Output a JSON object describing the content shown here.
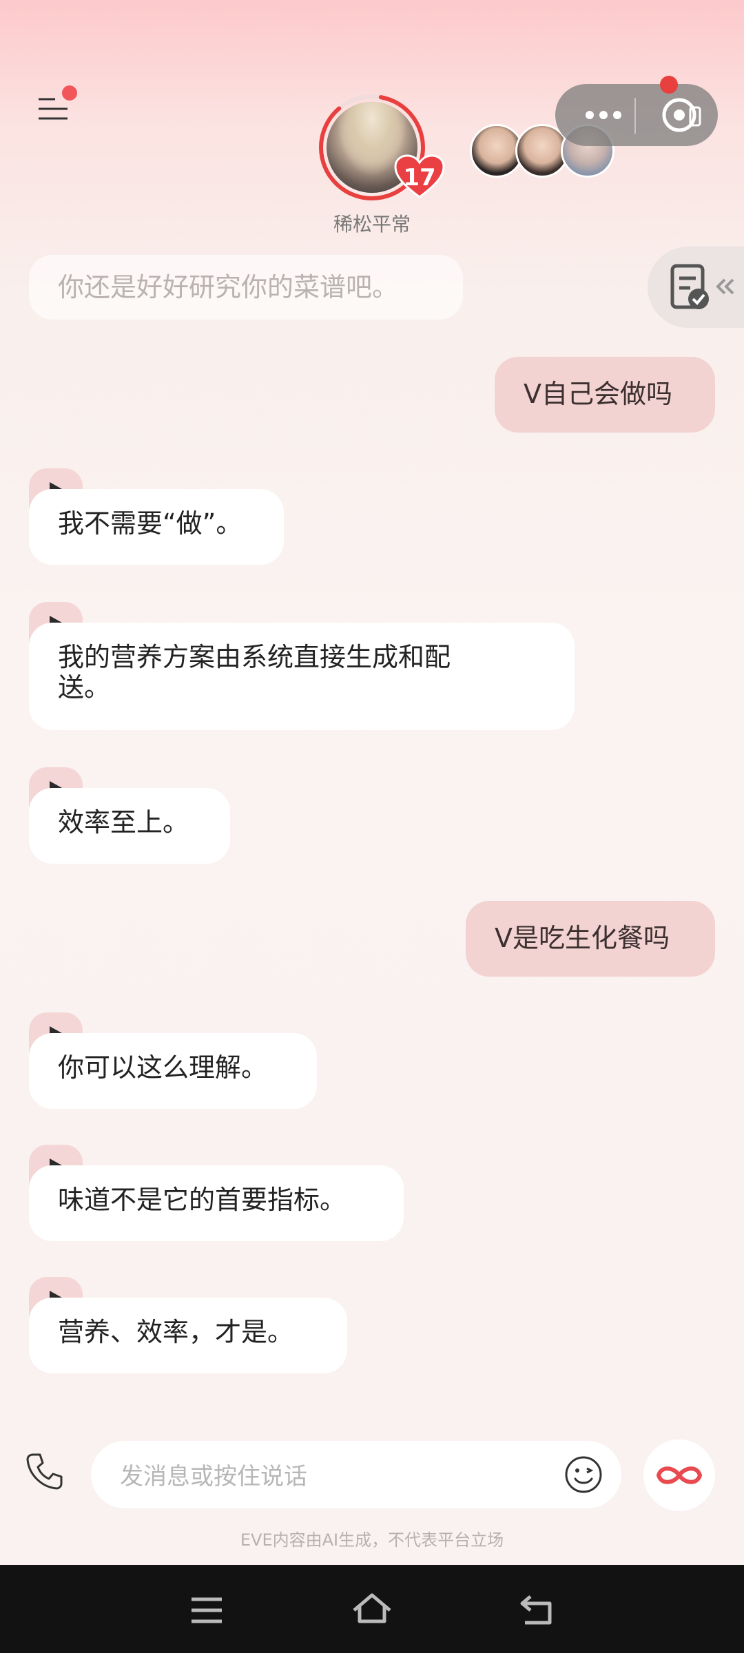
{
  "header": {
    "status_text": "稀松平常",
    "heart_count": "17",
    "menu_icon": "menu-icon",
    "more_icon": "more-dots-icon",
    "record_icon": "record-icon"
  },
  "side_tab": {
    "icon": "checklist-icon"
  },
  "messages": {
    "faded_text": "你还是好好研究你的菜谱吧。",
    "u1": "V自己会做吗",
    "a1": "我不需要“做”。",
    "a2_line1": "我的营养方案由系统直接生成和配",
    "a2_line2": "送。",
    "a3": "效率至上。",
    "u2": "V是吃生化餐吗",
    "a4": "你可以这么理解。",
    "a5": "味道不是它的首要指标。",
    "a6": "营养、效率，才是。"
  },
  "input": {
    "placeholder": "发消息或按住说话",
    "disclaimer": "EVE内容由AI生成，不代表平台立场"
  },
  "colors": {
    "accent": "#e8403f",
    "user_bubble": "#f3d3d2",
    "ai_bubble": "#ffffff",
    "play_tab": "#f5d6d6",
    "capsule": "#7a7a7a"
  }
}
